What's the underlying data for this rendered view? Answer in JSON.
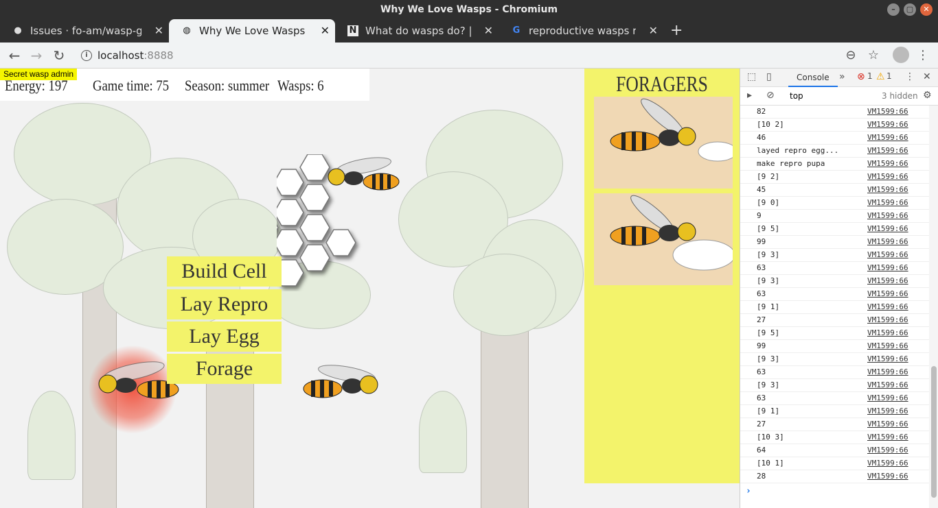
{
  "window": {
    "title": "Why We Love Wasps - Chromium"
  },
  "tabs": [
    {
      "label": "Issues · fo-am/wasp-game",
      "icon": "github-icon"
    },
    {
      "label": "Why We Love Wasps",
      "icon": "globe-icon"
    },
    {
      "label": "What do wasps do? | Natu",
      "icon": "notion-icon"
    },
    {
      "label": "reproductive wasps role i",
      "icon": "google-icon"
    }
  ],
  "address": {
    "host": "localhost",
    "port": ":8888"
  },
  "hud": {
    "admin": "Secret wasp admin",
    "energy": "Energy: 197",
    "game_time": "Game time: 75",
    "season": "Season: summer",
    "wasps": "Wasps: 6"
  },
  "menu": {
    "build_cell": "Build Cell",
    "lay_repro_egg": "Lay Repro Egg",
    "lay_egg": "Lay Egg",
    "forage": "Forage"
  },
  "foragers": {
    "title": "FORAGERS"
  },
  "devtools": {
    "tab": "Console",
    "errors": "1",
    "warnings": "1",
    "context": "top",
    "hidden": "3 hidden",
    "logs": [
      {
        "msg": "82",
        "src": "VM1599:66"
      },
      {
        "msg": "[10 2]",
        "src": "VM1599:66"
      },
      {
        "msg": "46",
        "src": "VM1599:66"
      },
      {
        "msg": "layed repro egg...",
        "src": "VM1599:66"
      },
      {
        "msg": "make repro pupa",
        "src": "VM1599:66"
      },
      {
        "msg": "[9 2]",
        "src": "VM1599:66"
      },
      {
        "msg": "45",
        "src": "VM1599:66"
      },
      {
        "msg": "[9 0]",
        "src": "VM1599:66"
      },
      {
        "msg": "9",
        "src": "VM1599:66"
      },
      {
        "msg": "[9 5]",
        "src": "VM1599:66"
      },
      {
        "msg": "99",
        "src": "VM1599:66"
      },
      {
        "msg": "[9 3]",
        "src": "VM1599:66"
      },
      {
        "msg": "63",
        "src": "VM1599:66"
      },
      {
        "msg": "[9 3]",
        "src": "VM1599:66"
      },
      {
        "msg": "63",
        "src": "VM1599:66"
      },
      {
        "msg": "[9 1]",
        "src": "VM1599:66"
      },
      {
        "msg": "27",
        "src": "VM1599:66"
      },
      {
        "msg": "[9 5]",
        "src": "VM1599:66"
      },
      {
        "msg": "99",
        "src": "VM1599:66"
      },
      {
        "msg": "[9 3]",
        "src": "VM1599:66"
      },
      {
        "msg": "63",
        "src": "VM1599:66"
      },
      {
        "msg": "[9 3]",
        "src": "VM1599:66"
      },
      {
        "msg": "63",
        "src": "VM1599:66"
      },
      {
        "msg": "[9 1]",
        "src": "VM1599:66"
      },
      {
        "msg": "27",
        "src": "VM1599:66"
      },
      {
        "msg": "[10 3]",
        "src": "VM1599:66"
      },
      {
        "msg": "64",
        "src": "VM1599:66"
      },
      {
        "msg": "[10 1]",
        "src": "VM1599:66"
      },
      {
        "msg": "28",
        "src": "VM1599:66"
      }
    ]
  }
}
